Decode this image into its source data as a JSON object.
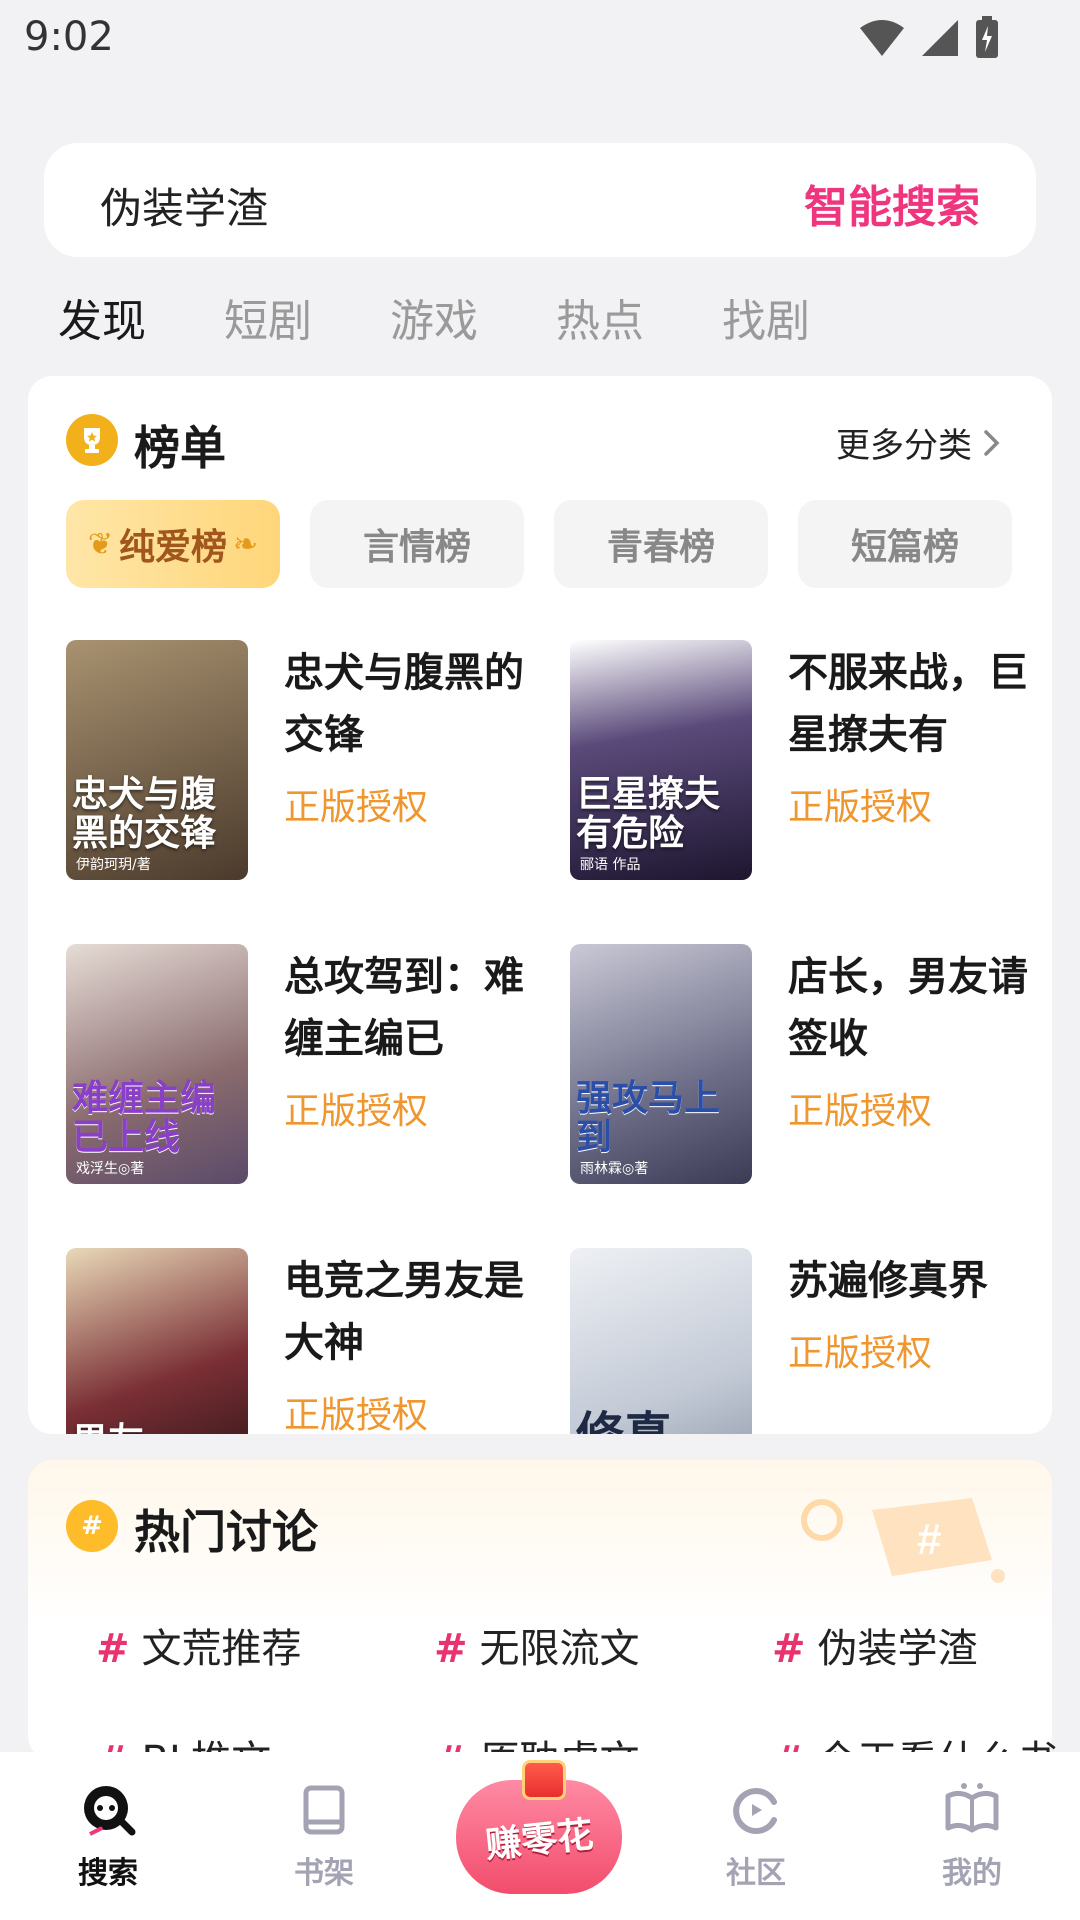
{
  "status_bar": {
    "time": "9:02"
  },
  "search": {
    "query": "伪装学渣",
    "action_label": "智能搜索"
  },
  "tabs": [
    {
      "label": "发现",
      "active": true
    },
    {
      "label": "短剧",
      "active": false
    },
    {
      "label": "游戏",
      "active": false
    },
    {
      "label": "热点",
      "active": false
    },
    {
      "label": "找剧",
      "active": false
    }
  ],
  "ranking": {
    "title": "榜单",
    "more_label": "更多分类",
    "rank_tabs": [
      {
        "label": "纯爱榜",
        "active": true
      },
      {
        "label": "言情榜",
        "active": false
      },
      {
        "label": "青春榜",
        "active": false
      },
      {
        "label": "短篇榜",
        "active": false
      }
    ],
    "books": [
      {
        "name": "忠犬与腹黑的交锋",
        "tag": "正版授权",
        "cover_text": "忠犬与腹黑的交锋",
        "cover_author": "伊韵珂玥/著",
        "cover_color": "#6b5a47"
      },
      {
        "name": "不服来战，巨星撩夫有",
        "tag": "正版授权",
        "cover_text": "巨星撩夫有危险",
        "cover_author": "郦语 作品",
        "cover_color": "#2a2240"
      },
      {
        "name": "总攻驾到：难缠主编已",
        "tag": "正版授权",
        "cover_text": "难缠主编已上线",
        "cover_author": "戏浮生◎著",
        "cover_color": "#b9a6a2"
      },
      {
        "name": "店长，男友请签收",
        "tag": "正版授权",
        "cover_text": "强攻马上到",
        "cover_author": "雨林霖◎著",
        "cover_color": "#8f8fa8"
      },
      {
        "name": "电竞之男友是大神",
        "tag": "正版授权",
        "cover_text": "男友",
        "cover_author": "",
        "cover_color": "#5a2b2f"
      },
      {
        "name": "苏遍修真界",
        "tag": "正版授权",
        "cover_text": "修真",
        "cover_author": "",
        "cover_color": "#d7dbe3"
      }
    ]
  },
  "hot": {
    "title": "热门讨论",
    "topics": [
      "文荒推荐",
      "无限流文",
      "伪装学渣",
      "BL推文",
      "原耽虐文",
      "今天看什么书"
    ]
  },
  "bottom_nav": {
    "items": [
      {
        "label": "搜索",
        "active": true
      },
      {
        "label": "书架",
        "active": false
      },
      {
        "label": "社区",
        "active": false
      },
      {
        "label": "我的",
        "active": false
      }
    ],
    "earn_label": "赚零花"
  }
}
